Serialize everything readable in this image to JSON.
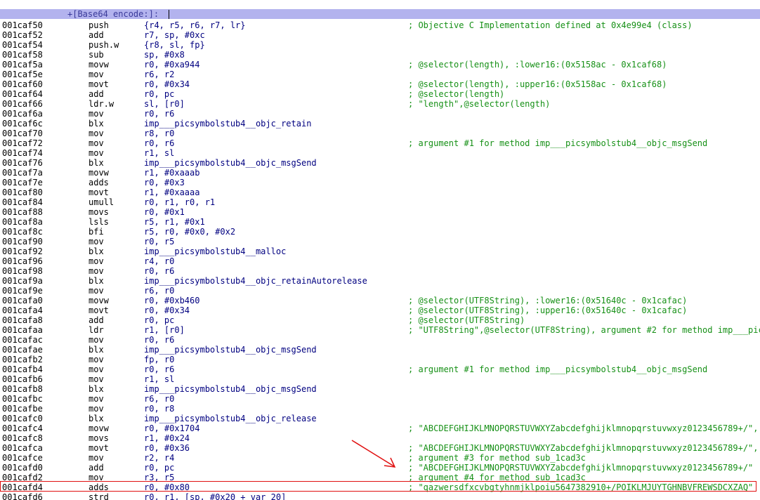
{
  "header": {
    "label": "+[Base64 encode:]:"
  },
  "rows": [
    {
      "addr": "001caf50",
      "mnem": "push",
      "ops": "{r4, r5, r6, r7, lr}",
      "cmt": "; Objective C Implementation defined at 0x4e99e4 (class)"
    },
    {
      "addr": "001caf52",
      "mnem": "add",
      "ops": "r7, sp, #0xc",
      "cmt": ""
    },
    {
      "addr": "001caf54",
      "mnem": "push.w",
      "ops": "{r8, sl, fp}",
      "cmt": ""
    },
    {
      "addr": "001caf58",
      "mnem": "sub",
      "ops": "sp, #0x8",
      "cmt": ""
    },
    {
      "addr": "001caf5a",
      "mnem": "movw",
      "ops": "r0, #0xa944",
      "cmt": "; @selector(length), :lower16:(0x5158ac - 0x1caf68)"
    },
    {
      "addr": "001caf5e",
      "mnem": "mov",
      "ops": "r6, r2",
      "cmt": ""
    },
    {
      "addr": "001caf60",
      "mnem": "movt",
      "ops": "r0, #0x34",
      "cmt": "; @selector(length), :upper16:(0x5158ac - 0x1caf68)"
    },
    {
      "addr": "001caf64",
      "mnem": "add",
      "ops": "r0, pc",
      "cmt": "; @selector(length)"
    },
    {
      "addr": "001caf66",
      "mnem": "ldr.w",
      "ops": "sl, [r0]",
      "cmt": "; \"length\",@selector(length)"
    },
    {
      "addr": "001caf6a",
      "mnem": "mov",
      "ops": "r0, r6",
      "cmt": ""
    },
    {
      "addr": "001caf6c",
      "mnem": "blx",
      "ops": "imp___picsymbolstub4__objc_retain",
      "cmt": ""
    },
    {
      "addr": "001caf70",
      "mnem": "mov",
      "ops": "r8, r0",
      "cmt": ""
    },
    {
      "addr": "001caf72",
      "mnem": "mov",
      "ops": "r0, r6",
      "cmt": "; argument #1 for method imp___picsymbolstub4__objc_msgSend"
    },
    {
      "addr": "001caf74",
      "mnem": "mov",
      "ops": "r1, sl",
      "cmt": ""
    },
    {
      "addr": "001caf76",
      "mnem": "blx",
      "ops": "imp___picsymbolstub4__objc_msgSend",
      "cmt": ""
    },
    {
      "addr": "001caf7a",
      "mnem": "movw",
      "ops": "r1, #0xaaab",
      "cmt": ""
    },
    {
      "addr": "001caf7e",
      "mnem": "adds",
      "ops": "r0, #0x3",
      "cmt": ""
    },
    {
      "addr": "001caf80",
      "mnem": "movt",
      "ops": "r1, #0xaaaa",
      "cmt": ""
    },
    {
      "addr": "001caf84",
      "mnem": "umull",
      "ops": "r0, r1, r0, r1",
      "cmt": ""
    },
    {
      "addr": "001caf88",
      "mnem": "movs",
      "ops": "r0, #0x1",
      "cmt": ""
    },
    {
      "addr": "001caf8a",
      "mnem": "lsls",
      "ops": "r5, r1, #0x1",
      "cmt": ""
    },
    {
      "addr": "001caf8c",
      "mnem": "bfi",
      "ops": "r5, r0, #0x0, #0x2",
      "cmt": ""
    },
    {
      "addr": "001caf90",
      "mnem": "mov",
      "ops": "r0, r5",
      "cmt": ""
    },
    {
      "addr": "001caf92",
      "mnem": "blx",
      "ops": "imp___picsymbolstub4__malloc",
      "cmt": ""
    },
    {
      "addr": "001caf96",
      "mnem": "mov",
      "ops": "r4, r0",
      "cmt": ""
    },
    {
      "addr": "001caf98",
      "mnem": "mov",
      "ops": "r0, r6",
      "cmt": ""
    },
    {
      "addr": "001caf9a",
      "mnem": "blx",
      "ops": "imp___picsymbolstub4__objc_retainAutorelease",
      "cmt": ""
    },
    {
      "addr": "001caf9e",
      "mnem": "mov",
      "ops": "r6, r0",
      "cmt": ""
    },
    {
      "addr": "001cafa0",
      "mnem": "movw",
      "ops": "r0, #0xb460",
      "cmt": "; @selector(UTF8String), :lower16:(0x51640c - 0x1cafac)"
    },
    {
      "addr": "001cafa4",
      "mnem": "movt",
      "ops": "r0, #0x34",
      "cmt": "; @selector(UTF8String), :upper16:(0x51640c - 0x1cafac)"
    },
    {
      "addr": "001cafa8",
      "mnem": "add",
      "ops": "r0, pc",
      "cmt": "; @selector(UTF8String)"
    },
    {
      "addr": "001cafaa",
      "mnem": "ldr",
      "ops": "r1, [r0]",
      "cmt": "; \"UTF8String\",@selector(UTF8String), argument #2 for method imp___pic"
    },
    {
      "addr": "001cafac",
      "mnem": "mov",
      "ops": "r0, r6",
      "cmt": ""
    },
    {
      "addr": "001cafae",
      "mnem": "blx",
      "ops": "imp___picsymbolstub4__objc_msgSend",
      "cmt": ""
    },
    {
      "addr": "001cafb2",
      "mnem": "mov",
      "ops": "fp, r0",
      "cmt": ""
    },
    {
      "addr": "001cafb4",
      "mnem": "mov",
      "ops": "r0, r6",
      "cmt": "; argument #1 for method imp___picsymbolstub4__objc_msgSend"
    },
    {
      "addr": "001cafb6",
      "mnem": "mov",
      "ops": "r1, sl",
      "cmt": ""
    },
    {
      "addr": "001cafb8",
      "mnem": "blx",
      "ops": "imp___picsymbolstub4__objc_msgSend",
      "cmt": ""
    },
    {
      "addr": "001cafbc",
      "mnem": "mov",
      "ops": "r6, r0",
      "cmt": ""
    },
    {
      "addr": "001cafbe",
      "mnem": "mov",
      "ops": "r0, r8",
      "cmt": ""
    },
    {
      "addr": "001cafc0",
      "mnem": "blx",
      "ops": "imp___picsymbolstub4__objc_release",
      "cmt": ""
    },
    {
      "addr": "001cafc4",
      "mnem": "movw",
      "ops": "r0, #0x1704",
      "cmt": "; \"ABCDEFGHIJKLMNOPQRSTUVWXYZabcdefghijklmnopqrstuvwxyz0123456789+/\","
    },
    {
      "addr": "001cafc8",
      "mnem": "movs",
      "ops": "r1, #0x24",
      "cmt": ""
    },
    {
      "addr": "001cafca",
      "mnem": "movt",
      "ops": "r0, #0x36",
      "cmt": "; \"ABCDEFGHIJKLMNOPQRSTUVWXYZabcdefghijklmnopqrstuvwxyz0123456789+/\","
    },
    {
      "addr": "001cafce",
      "mnem": "mov",
      "ops": "r2, r4",
      "cmt": "; argument #3 for method sub_1cad3c"
    },
    {
      "addr": "001cafd0",
      "mnem": "add",
      "ops": "r0, pc",
      "cmt": "; \"ABCDEFGHIJKLMNOPQRSTUVWXYZabcdefghijklmnopqrstuvwxyz0123456789+/\""
    },
    {
      "addr": "001cafd2",
      "mnem": "mov",
      "ops": "r3, r5",
      "cmt": "; argument #4 for method sub_1cad3c"
    },
    {
      "addr": "001cafd4",
      "mnem": "adds",
      "ops": "r0, #0x80",
      "cmt": "; \"qazwersdfxcvbgtyhnmjklpoiu5647382910+/POIKLMJUYTGHNBVFREWSDCXZAQ\""
    },
    {
      "addr": "001cafd6",
      "mnem": "strd",
      "ops": "r0, r1, [sp, #0x20 + var_20]",
      "cmt": ""
    }
  ],
  "annotation": {
    "highlight_color": "#e01010",
    "arrow_color": "#e01010"
  }
}
